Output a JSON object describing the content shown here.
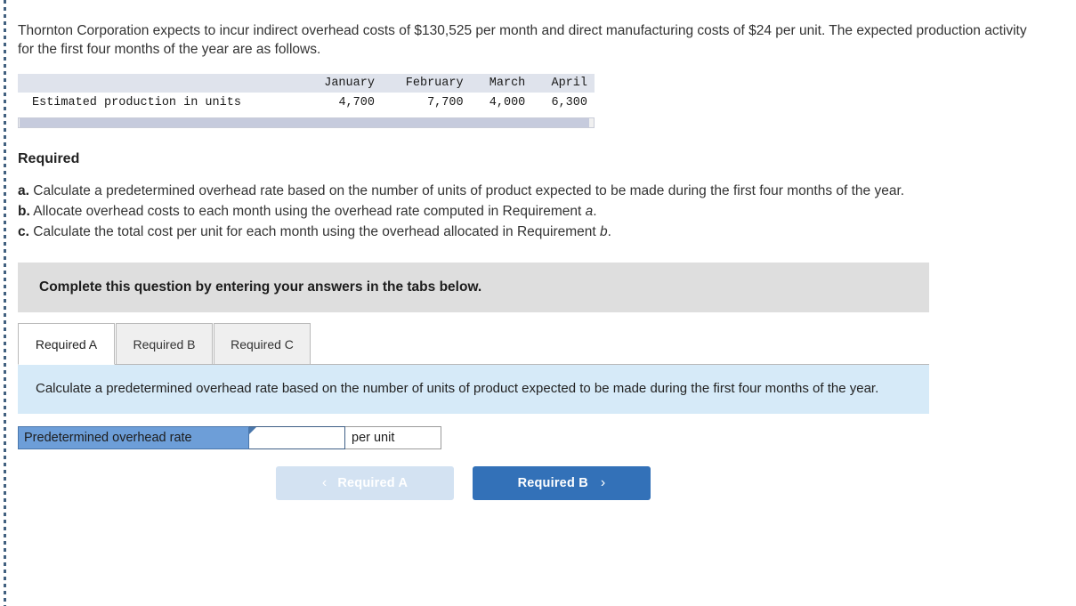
{
  "problem": {
    "intro": "Thornton Corporation expects to incur indirect overhead costs of $130,525 per month and direct manufacturing costs of $24 per unit. The expected production activity for the first four months of the year are as follows."
  },
  "data_table": {
    "row_label_header": "",
    "columns": [
      "January",
      "February",
      "March",
      "April"
    ],
    "rows": [
      {
        "label": "Estimated production in units",
        "values": [
          "4,700",
          "7,700",
          "4,000",
          "6,300"
        ]
      }
    ]
  },
  "required": {
    "heading": "Required",
    "items": [
      {
        "marker": "a.",
        "text_before": "Calculate a predetermined overhead rate based on the number of units of product expected to be made during the first four months of the year.",
        "emphasis": "",
        "text_after": ""
      },
      {
        "marker": "b.",
        "text_before": "Allocate overhead costs to each month using the overhead rate computed in Requirement ",
        "emphasis": "a",
        "text_after": "."
      },
      {
        "marker": "c.",
        "text_before": "Calculate the total cost per unit for each month using the overhead allocated in Requirement ",
        "emphasis": "b",
        "text_after": "."
      }
    ]
  },
  "banner": {
    "text": "Complete this question by entering your answers in the tabs below."
  },
  "tabs": [
    {
      "label": "Required A",
      "active": true
    },
    {
      "label": "Required B",
      "active": false
    },
    {
      "label": "Required C",
      "active": false
    }
  ],
  "panel": {
    "prompt": "Calculate a predetermined overhead rate based on the number of units of product expected to be made during the first four months of the year."
  },
  "answer": {
    "label": "Predetermined overhead rate",
    "value": "",
    "placeholder": "",
    "unit": "per unit"
  },
  "nav": {
    "prev_label": "Required A",
    "prev_chevron": "‹",
    "next_label": "Required B",
    "next_chevron": "›"
  },
  "colors": {
    "accent_blue": "#3371b8",
    "panel_blue": "#d6eaf8",
    "label_blue": "#6d9ed8",
    "banner_gray": "#dedede",
    "table_header": "#dfe3ec"
  }
}
